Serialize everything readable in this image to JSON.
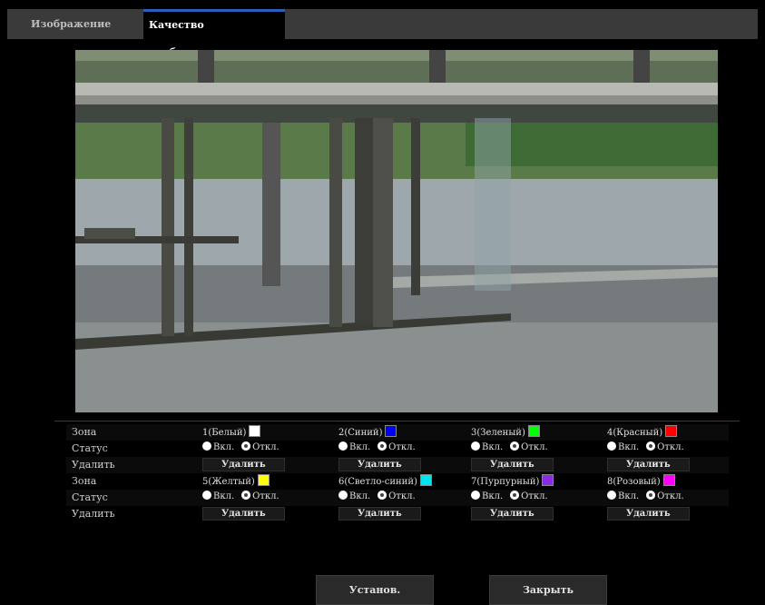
{
  "tabs": [
    {
      "label": "Изображение",
      "active": false
    },
    {
      "label": "Качество изображения",
      "active": true
    }
  ],
  "labels": {
    "zone": "Зона",
    "status": "Статус",
    "delete": "Удалить",
    "on": "Вкл.",
    "off": "Откл."
  },
  "zones_row1": [
    {
      "name": "1(Белый)",
      "color": "#ffffff",
      "status": "off",
      "delete_label": "Удалить"
    },
    {
      "name": "2(Синий)",
      "color": "#0000ff",
      "status": "off",
      "delete_label": "Удалить"
    },
    {
      "name": "3(Зеленый)",
      "color": "#00ff00",
      "status": "off",
      "delete_label": "Удалить"
    },
    {
      "name": "4(Красный)",
      "color": "#ff0000",
      "status": "off",
      "delete_label": "Удалить"
    }
  ],
  "zones_row2": [
    {
      "name": "5(Желтый)",
      "color": "#ffff00",
      "status": "off",
      "delete_label": "Удалить"
    },
    {
      "name": "6(Светло-синий)",
      "color": "#00e5ee",
      "status": "off",
      "delete_label": "Удалить"
    },
    {
      "name": "7(Пурпурный)",
      "color": "#8a2be2",
      "status": "off",
      "delete_label": "Удалить"
    },
    {
      "name": "8(Розовый)",
      "color": "#ff00ff",
      "status": "off",
      "delete_label": "Удалить"
    }
  ],
  "buttons": {
    "set": "Установ.",
    "close": "Закрыть"
  }
}
